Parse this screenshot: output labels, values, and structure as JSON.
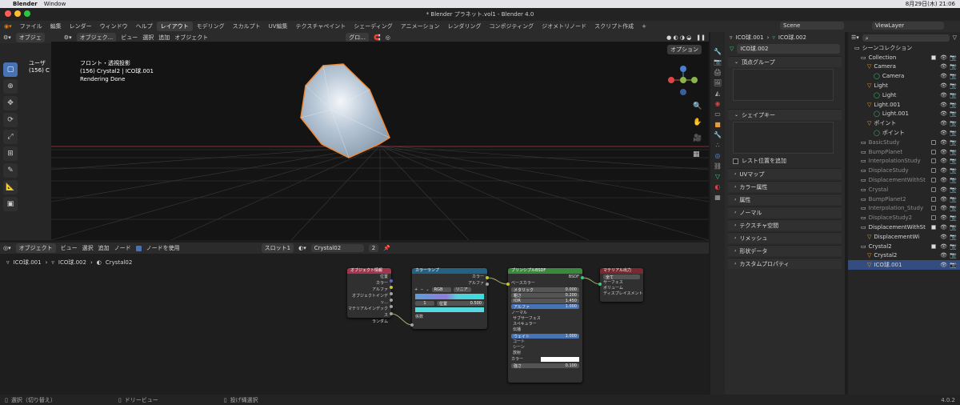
{
  "mac": {
    "app": "Blender",
    "menu": "Window",
    "clock": "8月29日(木) 21:06"
  },
  "window_title": "* Blender プラネット.vol1 - Blender 4.0",
  "menus": [
    "ファイル",
    "編集",
    "レンダー",
    "ウィンドウ",
    "ヘルプ"
  ],
  "workspaces": [
    "レイアウト",
    "モデリング",
    "スカルプト",
    "UV編集",
    "テクスチャペイント",
    "シェーディング",
    "アニメーション",
    "レンダリング",
    "コンポジティング",
    "ジオメトリノード",
    "スクリプト作成"
  ],
  "scene": "Scene",
  "view_layer": "ViewLayer",
  "viewport_header": {
    "mode": "オブジェク...",
    "items": [
      "ビュー",
      "選択",
      "追加",
      "オブジェクト"
    ],
    "transform": "グロ...",
    "options": "オプション"
  },
  "left_header": {
    "mode": "オブジェ"
  },
  "viewport_info": [
    "フロント・透視投影",
    "(156) Crystal2 | ICO球.001",
    "Rendering Done"
  ],
  "left_overlay": [
    "ユーザ",
    "(156) C"
  ],
  "node_header": {
    "mode": "オブジェクト",
    "items": [
      "ビュー",
      "選択",
      "追加",
      "ノード"
    ],
    "use_nodes": "ノードを使用",
    "slot": "スロット1",
    "material": "Crystal02",
    "users": "2"
  },
  "node_breadcrumb": [
    "ICO球.001",
    "ICO球.002",
    "Crystal02"
  ],
  "nodes": {
    "objinfo": {
      "title": "オブジェクト情報",
      "outputs": [
        "位置",
        "カラー",
        "アルファ",
        "オブジェクトインデッ...",
        "マテリアルインデックス",
        "ランダム"
      ]
    },
    "ramp": {
      "title": "カラーランプ",
      "outs": [
        "カラー",
        "アルファ"
      ],
      "mode": "RGB",
      "interp": "リニア",
      "index": "1",
      "pos_label": "位置",
      "pos": "0.500",
      "input": "係数"
    },
    "bsdf": {
      "title": "プリンシプルBSDF",
      "out": "BSDF",
      "rows": [
        "ベースカラー"
      ],
      "fields": [
        {
          "l": "メタリック",
          "v": "0.000"
        },
        {
          "l": "粗さ",
          "v": "0.200"
        },
        {
          "l": "IOR",
          "v": "1.450"
        },
        {
          "l": "アルファ",
          "v": "1.000"
        }
      ],
      "subs": [
        "ノーマル",
        "サブサーフェス",
        "スペキュラー",
        "伝播"
      ],
      "weight": {
        "l": "ウェイト",
        "v": "1.000"
      },
      "subs2": [
        "コート",
        "シーン",
        "放射"
      ],
      "color_label": "カラー",
      "strength": {
        "l": "強さ",
        "v": "0.100"
      }
    },
    "out": {
      "title": "マテリアル出力",
      "target": "全て",
      "rows": [
        "サーフェス",
        "ボリューム",
        "ディスプレイスメント"
      ]
    }
  },
  "props": {
    "obj1": "ICO球.001",
    "obj2": "ICO球.002",
    "mesh": "ICO球.002",
    "panels": [
      "頂点グループ",
      "シェイプキー"
    ],
    "relative": "レスト位置を追加",
    "more": [
      "UVマップ",
      "カラー属性",
      "属性",
      "ノーマル",
      "テクスチャ空間",
      "リメッシュ",
      "形状データ",
      "カスタムプロパティ"
    ]
  },
  "outliner": {
    "title": "シーンコレクション",
    "rows": [
      {
        "t": "Collection",
        "i": 1,
        "chk": true
      },
      {
        "t": "Camera",
        "i": 2,
        "chk": false
      },
      {
        "t": "Camera",
        "i": 3,
        "chk": false
      },
      {
        "t": "Light",
        "i": 2,
        "chk": false
      },
      {
        "t": "Light",
        "i": 3,
        "chk": false
      },
      {
        "t": "Light.001",
        "i": 2,
        "chk": false
      },
      {
        "t": "Light.001",
        "i": 3,
        "chk": false
      },
      {
        "t": "ポイント",
        "i": 2,
        "chk": false
      },
      {
        "t": "ポイント",
        "i": 3,
        "chk": false
      },
      {
        "t": "BasicStudy",
        "i": 1,
        "chk": false
      },
      {
        "t": "BumpPlanet",
        "i": 1,
        "chk": false
      },
      {
        "t": "InterpolationStudy",
        "i": 1,
        "chk": false
      },
      {
        "t": "DisplaceStudy",
        "i": 1,
        "chk": false
      },
      {
        "t": "DisplacementWithSt",
        "i": 1,
        "chk": false
      },
      {
        "t": "Crystal",
        "i": 1,
        "chk": false
      },
      {
        "t": "BumpPlanet2",
        "i": 1,
        "chk": false
      },
      {
        "t": "Interpolation_Study",
        "i": 1,
        "chk": false
      },
      {
        "t": "DisplaceStudy2",
        "i": 1,
        "chk": false
      },
      {
        "t": "DisplacementWithSt",
        "i": 1,
        "chk": true
      },
      {
        "t": "DisplacementWi",
        "i": 2,
        "chk": false
      },
      {
        "t": "Crystal2",
        "i": 1,
        "chk": true
      },
      {
        "t": "Crystal2",
        "i": 2,
        "chk": false
      },
      {
        "t": "ICO球.001",
        "i": 2,
        "chk": false
      }
    ]
  },
  "status": [
    "選択（切り替え）",
    "ドリービュー",
    "投げ縄選択"
  ],
  "version": "4.0.2",
  "colors": {
    "accent": "#4772b3",
    "selection": "#f08a38"
  }
}
